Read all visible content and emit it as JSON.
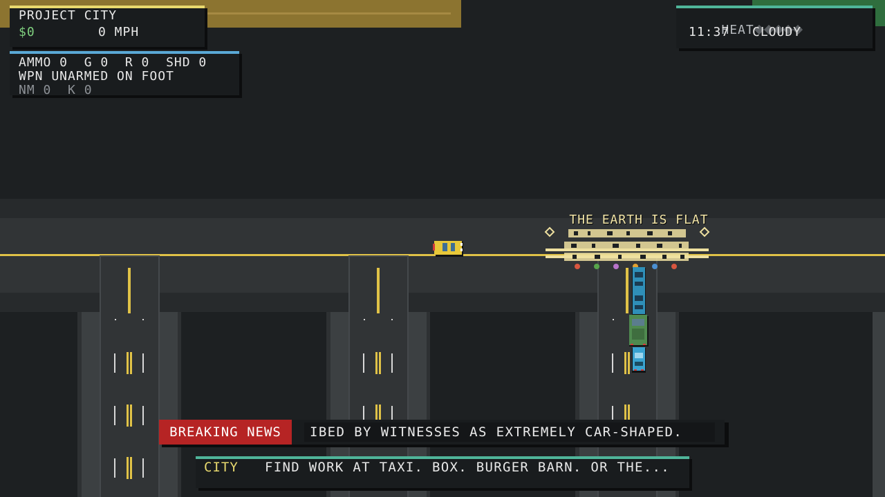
{
  "hud": {
    "title": "PROJECT CITY",
    "money": "$0",
    "speed": "0 MPH",
    "ammo_line": "AMMO 0  G 0  R 0  SHD 0",
    "weapon_line": "WPN UNARMED ON FOOT",
    "stats_line": "NM 0  K 0"
  },
  "status": {
    "heat_label": "HEAT",
    "heat_level": 0,
    "heat_max": 5,
    "time": "11:37",
    "weather": "CLOUDY"
  },
  "world": {
    "billboard_text": "THE EARTH IS FLAT"
  },
  "news": {
    "label": "BREAKING NEWS",
    "ticker": "IBED BY WITNESSES AS EXTREMELY CAR-SHAPED."
  },
  "hint": {
    "label": "CITY",
    "text": "FIND WORK AT TAXI. BOX. BURGER BARN. OR THE..."
  },
  "colors": {
    "hud_accent": "#e8d96e",
    "ammo_accent": "#5aa9d6",
    "status_accent": "#4fb59a",
    "money_green": "#7fd07f",
    "news_red": "#b62424",
    "road_line_yellow": "#e0c247"
  }
}
